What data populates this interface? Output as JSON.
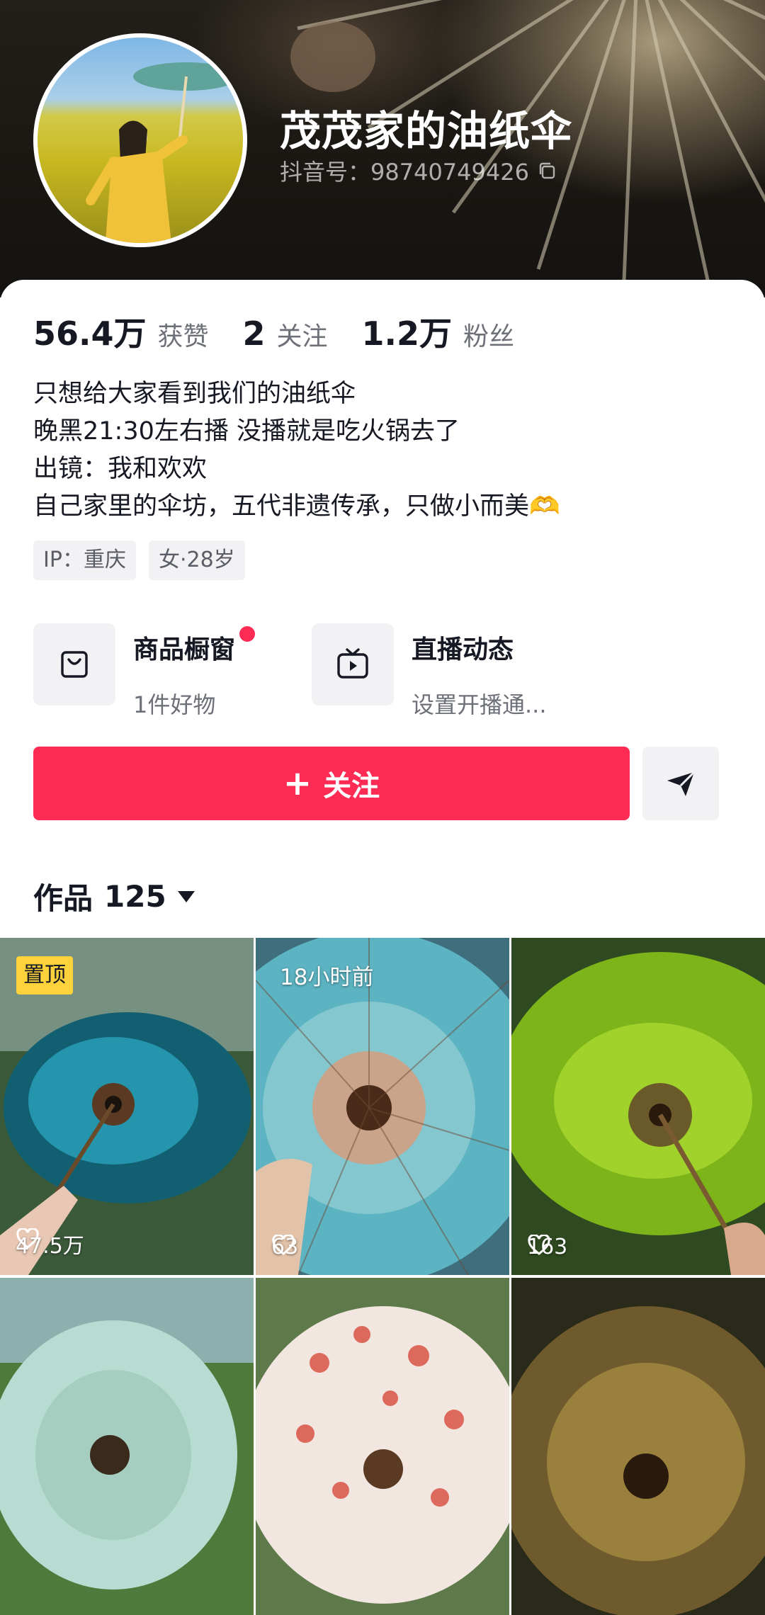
{
  "profile": {
    "name": "茂茂家的油纸伞",
    "douyin_id": "抖音号：98740749426"
  },
  "stats": [
    {
      "value": "56.4万",
      "label": "获赞"
    },
    {
      "value": "2",
      "label": "关注"
    },
    {
      "value": "1.2万",
      "label": "粉丝"
    }
  ],
  "bio": [
    "只想给大家看到我们的油纸伞",
    "晚黑21:30左右播 没播就是吃火锅去了",
    "出镜：我和欢欢",
    "自己家里的伞坊，五代非遗传承，只做小而美🫶"
  ],
  "tags": [
    "IP：重庆",
    "女·28岁"
  ],
  "features": {
    "shop": {
      "title": "商品橱窗",
      "sub": "1件好物",
      "icon": "shopping-bag-icon",
      "has_dot": true
    },
    "live": {
      "title": "直播动态",
      "sub": "设置开播通...",
      "icon": "tv-icon"
    }
  },
  "actions": {
    "follow_label": "关注",
    "send_icon": "send-icon"
  },
  "works": {
    "label": "作品",
    "count": "125"
  },
  "videos": [
    {
      "badge": "置顶",
      "likes": "47.5万",
      "color": "#1d7f95"
    },
    {
      "time": "18小时前",
      "likes": "63",
      "color": "#5cb3c2"
    },
    {
      "likes": "163",
      "color": "#8fc51f"
    },
    {
      "color": "#b8dcd2"
    },
    {
      "color": "#f2e6e0"
    },
    {
      "color": "#6e5a2c"
    }
  ],
  "colors": {
    "accent": "#fe2c55",
    "pin_badge": "#fdd23b"
  }
}
